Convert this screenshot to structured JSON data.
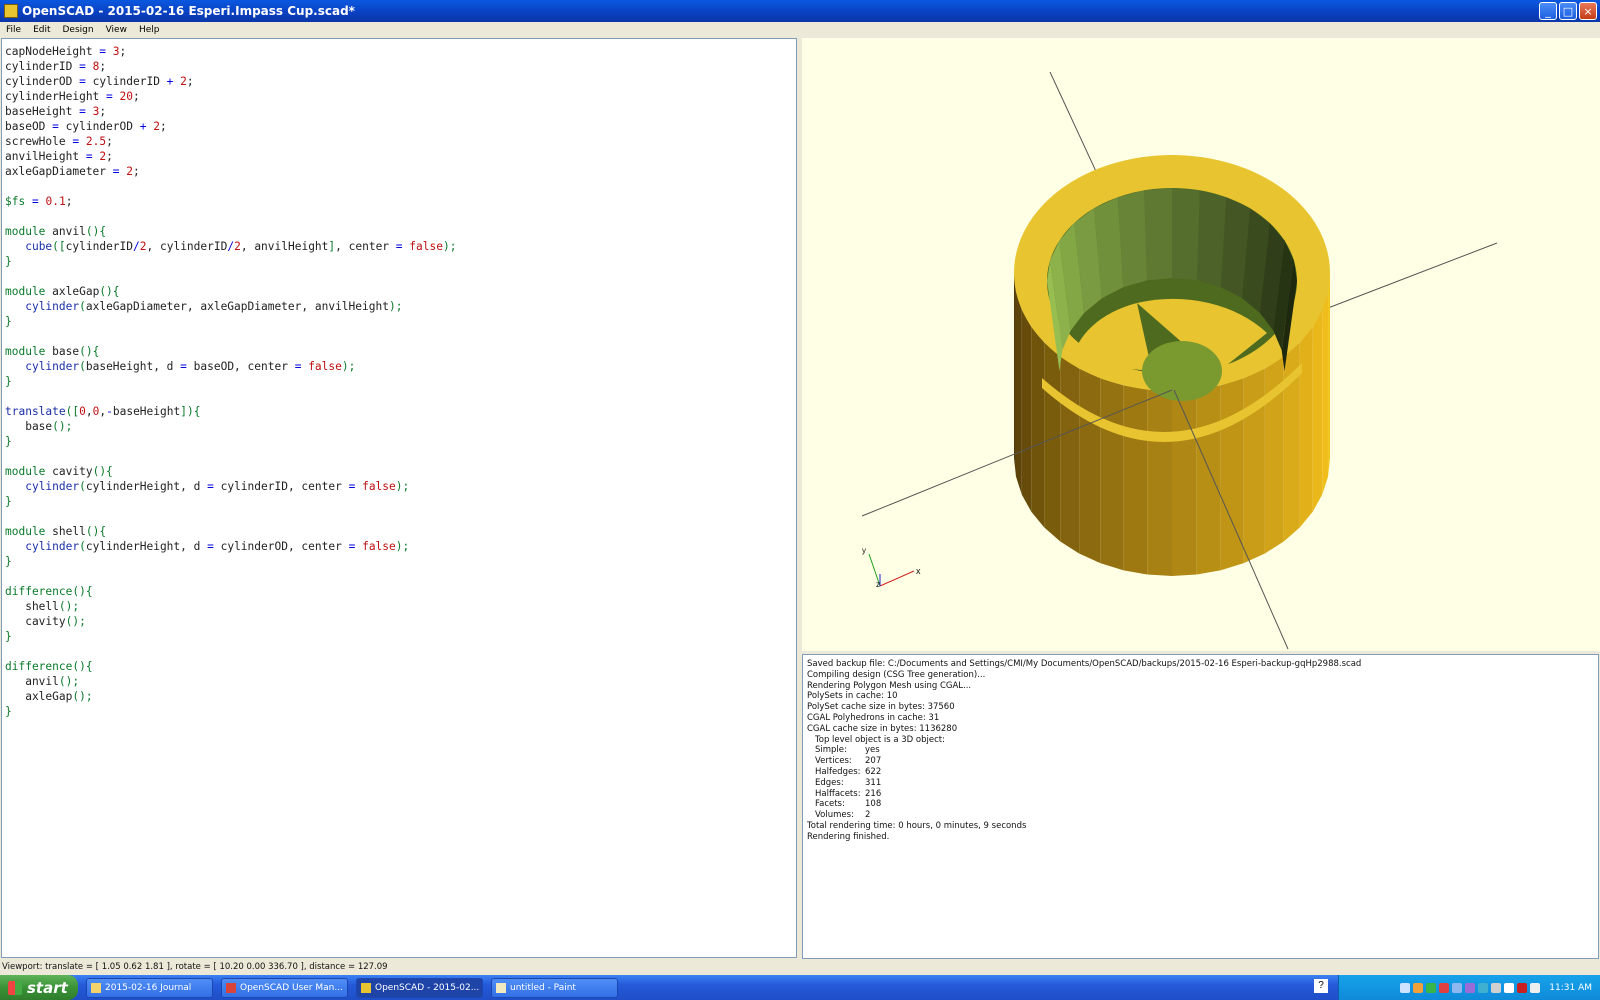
{
  "window": {
    "title": "OpenSCAD - 2015-02-16 Esperi.Impass Cup.scad*",
    "minimize": "_",
    "maximize": "□",
    "close": "×"
  },
  "menu": [
    "File",
    "Edit",
    "Design",
    "View",
    "Help"
  ],
  "editor": {
    "lines": [
      [
        {
          "t": "capNodeHeight ",
          "c": "p"
        },
        {
          "t": "=",
          "c": "o"
        },
        {
          "t": " ",
          "c": "p"
        },
        {
          "t": "3",
          "c": "n"
        },
        {
          "t": ";",
          "c": "p"
        }
      ],
      [
        {
          "t": "cylinderID ",
          "c": "p"
        },
        {
          "t": "=",
          "c": "o"
        },
        {
          "t": " ",
          "c": "p"
        },
        {
          "t": "8",
          "c": "n"
        },
        {
          "t": ";",
          "c": "p"
        }
      ],
      [
        {
          "t": "cylinderOD ",
          "c": "p"
        },
        {
          "t": "=",
          "c": "o"
        },
        {
          "t": " cylinderID ",
          "c": "p"
        },
        {
          "t": "+",
          "c": "o"
        },
        {
          "t": " ",
          "c": "p"
        },
        {
          "t": "2",
          "c": "n"
        },
        {
          "t": ";",
          "c": "p"
        }
      ],
      [
        {
          "t": "cylinderHeight ",
          "c": "p"
        },
        {
          "t": "=",
          "c": "o"
        },
        {
          "t": " ",
          "c": "p"
        },
        {
          "t": "20",
          "c": "n"
        },
        {
          "t": ";",
          "c": "p"
        }
      ],
      [
        {
          "t": "baseHeight ",
          "c": "p"
        },
        {
          "t": "=",
          "c": "o"
        },
        {
          "t": " ",
          "c": "p"
        },
        {
          "t": "3",
          "c": "n"
        },
        {
          "t": ";",
          "c": "p"
        }
      ],
      [
        {
          "t": "baseOD ",
          "c": "p"
        },
        {
          "t": "=",
          "c": "o"
        },
        {
          "t": " cylinderOD ",
          "c": "p"
        },
        {
          "t": "+",
          "c": "o"
        },
        {
          "t": " ",
          "c": "p"
        },
        {
          "t": "2",
          "c": "n"
        },
        {
          "t": ";",
          "c": "p"
        }
      ],
      [
        {
          "t": "screwHole ",
          "c": "p"
        },
        {
          "t": "=",
          "c": "o"
        },
        {
          "t": " ",
          "c": "p"
        },
        {
          "t": "2.5",
          "c": "n"
        },
        {
          "t": ";",
          "c": "p"
        }
      ],
      [
        {
          "t": "anvilHeight ",
          "c": "p"
        },
        {
          "t": "=",
          "c": "o"
        },
        {
          "t": " ",
          "c": "p"
        },
        {
          "t": "2",
          "c": "n"
        },
        {
          "t": ";",
          "c": "p"
        }
      ],
      [
        {
          "t": "axleGapDiameter ",
          "c": "p"
        },
        {
          "t": "=",
          "c": "o"
        },
        {
          "t": " ",
          "c": "p"
        },
        {
          "t": "2",
          "c": "n"
        },
        {
          "t": ";",
          "c": "p"
        }
      ],
      [],
      [
        {
          "t": "$fs",
          "c": "k"
        },
        {
          "t": " ",
          "c": "p"
        },
        {
          "t": "=",
          "c": "o"
        },
        {
          "t": " ",
          "c": "p"
        },
        {
          "t": "0.1",
          "c": "n"
        },
        {
          "t": ";",
          "c": "p"
        }
      ],
      [],
      [
        {
          "t": "module",
          "c": "k"
        },
        {
          "t": " anvil",
          "c": "p"
        },
        {
          "t": "(){",
          "c": "k"
        }
      ],
      [
        {
          "t": "   ",
          "c": "p"
        },
        {
          "t": "cube",
          "c": "f"
        },
        {
          "t": "([",
          "c": "k"
        },
        {
          "t": "cylinderID",
          "c": "p"
        },
        {
          "t": "/",
          "c": "o"
        },
        {
          "t": "2",
          "c": "n"
        },
        {
          "t": ", cylinderID",
          "c": "p"
        },
        {
          "t": "/",
          "c": "o"
        },
        {
          "t": "2",
          "c": "n"
        },
        {
          "t": ", anvilHeight",
          "c": "p"
        },
        {
          "t": "]",
          "c": "k"
        },
        {
          "t": ", center ",
          "c": "p"
        },
        {
          "t": "=",
          "c": "o"
        },
        {
          "t": " ",
          "c": "p"
        },
        {
          "t": "false",
          "c": "n"
        },
        {
          "t": ");",
          "c": "k"
        }
      ],
      [
        {
          "t": "}",
          "c": "k"
        }
      ],
      [],
      [
        {
          "t": "module",
          "c": "k"
        },
        {
          "t": " axleGap",
          "c": "p"
        },
        {
          "t": "(){",
          "c": "k"
        }
      ],
      [
        {
          "t": "   ",
          "c": "p"
        },
        {
          "t": "cylinder",
          "c": "f"
        },
        {
          "t": "(",
          "c": "k"
        },
        {
          "t": "axleGapDiameter, axleGapDiameter, anvilHeight",
          "c": "p"
        },
        {
          "t": ");",
          "c": "k"
        }
      ],
      [
        {
          "t": "}",
          "c": "k"
        }
      ],
      [],
      [
        {
          "t": "module",
          "c": "k"
        },
        {
          "t": " base",
          "c": "p"
        },
        {
          "t": "(){",
          "c": "k"
        }
      ],
      [
        {
          "t": "   ",
          "c": "p"
        },
        {
          "t": "cylinder",
          "c": "f"
        },
        {
          "t": "(",
          "c": "k"
        },
        {
          "t": "baseHeight, d ",
          "c": "p"
        },
        {
          "t": "=",
          "c": "o"
        },
        {
          "t": " baseOD, center ",
          "c": "p"
        },
        {
          "t": "=",
          "c": "o"
        },
        {
          "t": " ",
          "c": "p"
        },
        {
          "t": "false",
          "c": "n"
        },
        {
          "t": ");",
          "c": "k"
        }
      ],
      [
        {
          "t": "}",
          "c": "k"
        }
      ],
      [],
      [
        {
          "t": "translate",
          "c": "f"
        },
        {
          "t": "([",
          "c": "k"
        },
        {
          "t": "0",
          "c": "n"
        },
        {
          "t": ",",
          "c": "p"
        },
        {
          "t": "0",
          "c": "n"
        },
        {
          "t": ",",
          "c": "p"
        },
        {
          "t": "-",
          "c": "o"
        },
        {
          "t": "baseHeight",
          "c": "p"
        },
        {
          "t": "]){",
          "c": "k"
        }
      ],
      [
        {
          "t": "   base",
          "c": "p"
        },
        {
          "t": "();",
          "c": "k"
        }
      ],
      [
        {
          "t": "}",
          "c": "k"
        }
      ],
      [],
      [
        {
          "t": "module",
          "c": "k"
        },
        {
          "t": " cavity",
          "c": "p"
        },
        {
          "t": "(){",
          "c": "k"
        }
      ],
      [
        {
          "t": "   ",
          "c": "p"
        },
        {
          "t": "cylinder",
          "c": "f"
        },
        {
          "t": "(",
          "c": "k"
        },
        {
          "t": "cylinderHeight, d ",
          "c": "p"
        },
        {
          "t": "=",
          "c": "o"
        },
        {
          "t": " cylinderID, center ",
          "c": "p"
        },
        {
          "t": "=",
          "c": "o"
        },
        {
          "t": " ",
          "c": "p"
        },
        {
          "t": "false",
          "c": "n"
        },
        {
          "t": ");",
          "c": "k"
        }
      ],
      [
        {
          "t": "}",
          "c": "k"
        }
      ],
      [],
      [
        {
          "t": "module",
          "c": "k"
        },
        {
          "t": " shell",
          "c": "p"
        },
        {
          "t": "(){",
          "c": "k"
        }
      ],
      [
        {
          "t": "   ",
          "c": "p"
        },
        {
          "t": "cylinder",
          "c": "f"
        },
        {
          "t": "(",
          "c": "k"
        },
        {
          "t": "cylinderHeight, d ",
          "c": "p"
        },
        {
          "t": "=",
          "c": "o"
        },
        {
          "t": " cylinderOD, center ",
          "c": "p"
        },
        {
          "t": "=",
          "c": "o"
        },
        {
          "t": " ",
          "c": "p"
        },
        {
          "t": "false",
          "c": "n"
        },
        {
          "t": ");",
          "c": "k"
        }
      ],
      [
        {
          "t": "}",
          "c": "k"
        }
      ],
      [],
      [
        {
          "t": "difference",
          "c": "k"
        },
        {
          "t": "(){",
          "c": "k"
        }
      ],
      [
        {
          "t": "   shell",
          "c": "p"
        },
        {
          "t": "();",
          "c": "k"
        }
      ],
      [
        {
          "t": "   cavity",
          "c": "p"
        },
        {
          "t": "();",
          "c": "k"
        }
      ],
      [
        {
          "t": "}",
          "c": "k"
        }
      ],
      [],
      [
        {
          "t": "difference",
          "c": "k"
        },
        {
          "t": "(){",
          "c": "k"
        }
      ],
      [
        {
          "t": "   anvil",
          "c": "p"
        },
        {
          "t": "();",
          "c": "k"
        }
      ],
      [
        {
          "t": "   axleGap",
          "c": "p"
        },
        {
          "t": "();",
          "c": "k"
        }
      ],
      [
        {
          "t": "}",
          "c": "k"
        }
      ]
    ]
  },
  "viewport": {
    "background": "#ffffe5",
    "object_color": "#e8c530",
    "axis_labels": {
      "x": "x",
      "y": "y",
      "z": "z"
    }
  },
  "console": {
    "lines": [
      "Saved backup file: C:/Documents and Settings/CMI/My Documents/OpenSCAD/backups/2015-02-16 Esperi-backup-gqHp2988.scad",
      "Compiling design (CSG Tree generation)...",
      "Rendering Polygon Mesh using CGAL...",
      "PolySets in cache: 10",
      "PolySet cache size in bytes: 37560",
      "CGAL Polyhedrons in cache: 31",
      "CGAL cache size in bytes: 1136280"
    ],
    "top_level": "Top level object is a 3D object:",
    "stats": [
      {
        "k": "Simple:",
        "v": "yes"
      },
      {
        "k": "Vertices:",
        "v": "207"
      },
      {
        "k": "Halfedges:",
        "v": "622"
      },
      {
        "k": "Edges:",
        "v": "311"
      },
      {
        "k": "Halffacets:",
        "v": "216"
      },
      {
        "k": "Facets:",
        "v": "108"
      },
      {
        "k": "Volumes:",
        "v": "2"
      }
    ],
    "tail": [
      "Total rendering time: 0 hours, 0 minutes, 9 seconds",
      "Rendering finished."
    ]
  },
  "statusbar": "Viewport: translate = [ 1.05 0.62 1.81 ], rotate = [ 10.20 0.00 336.70 ], distance = 127.09",
  "taskbar": {
    "start": "start",
    "tasks": [
      {
        "label": "2015-02-16 Journal",
        "icon": "folder-icon",
        "color": "#f3d36a"
      },
      {
        "label": "OpenSCAD User Man...",
        "icon": "chrome-icon",
        "color": "#d9453a"
      },
      {
        "label": "OpenSCAD - 2015-02...",
        "icon": "openscad-icon",
        "color": "#e8c530",
        "active": true
      },
      {
        "label": "untitled - Paint",
        "icon": "paint-icon",
        "color": "#f1e9c0"
      }
    ],
    "help": "?",
    "clock": "11:31 AM"
  }
}
